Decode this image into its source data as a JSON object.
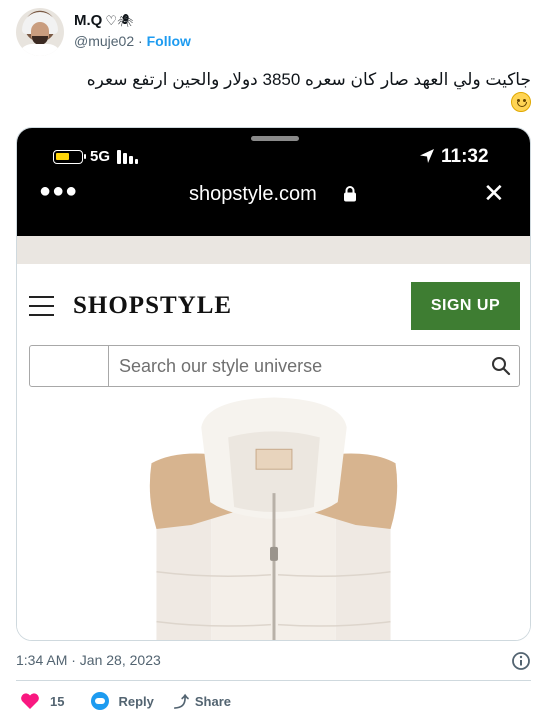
{
  "tweet": {
    "author_name": "M.Q",
    "author_emoji": "♡🕷",
    "handle": "@muje02",
    "follow_label": "Follow",
    "text": "جاكيت ولي العهد صار كان سعره 3850 دولار والحين ارتفع سعره",
    "emoji": "slightly-smiling-face",
    "timestamp": "1:34 AM · Jan 28, 2023",
    "likes": "15",
    "reply_label": "Reply",
    "share_label": "Share"
  },
  "screenshot": {
    "status_bar": {
      "network": "5G",
      "time": "11:32",
      "battery_color": "#ffd60a"
    },
    "browser": {
      "url": "shopstyle.com",
      "menu_icon": "more-dots-icon",
      "close_icon": "close-icon"
    },
    "site": {
      "logo": "SHOPSTYLE",
      "signup_label": "SIGN UP",
      "signup_color": "#3e7d32",
      "search_placeholder": "Search our style universe"
    }
  },
  "colors": {
    "link": "#1d9bf0",
    "like": "#f91880",
    "muted": "#536471"
  }
}
